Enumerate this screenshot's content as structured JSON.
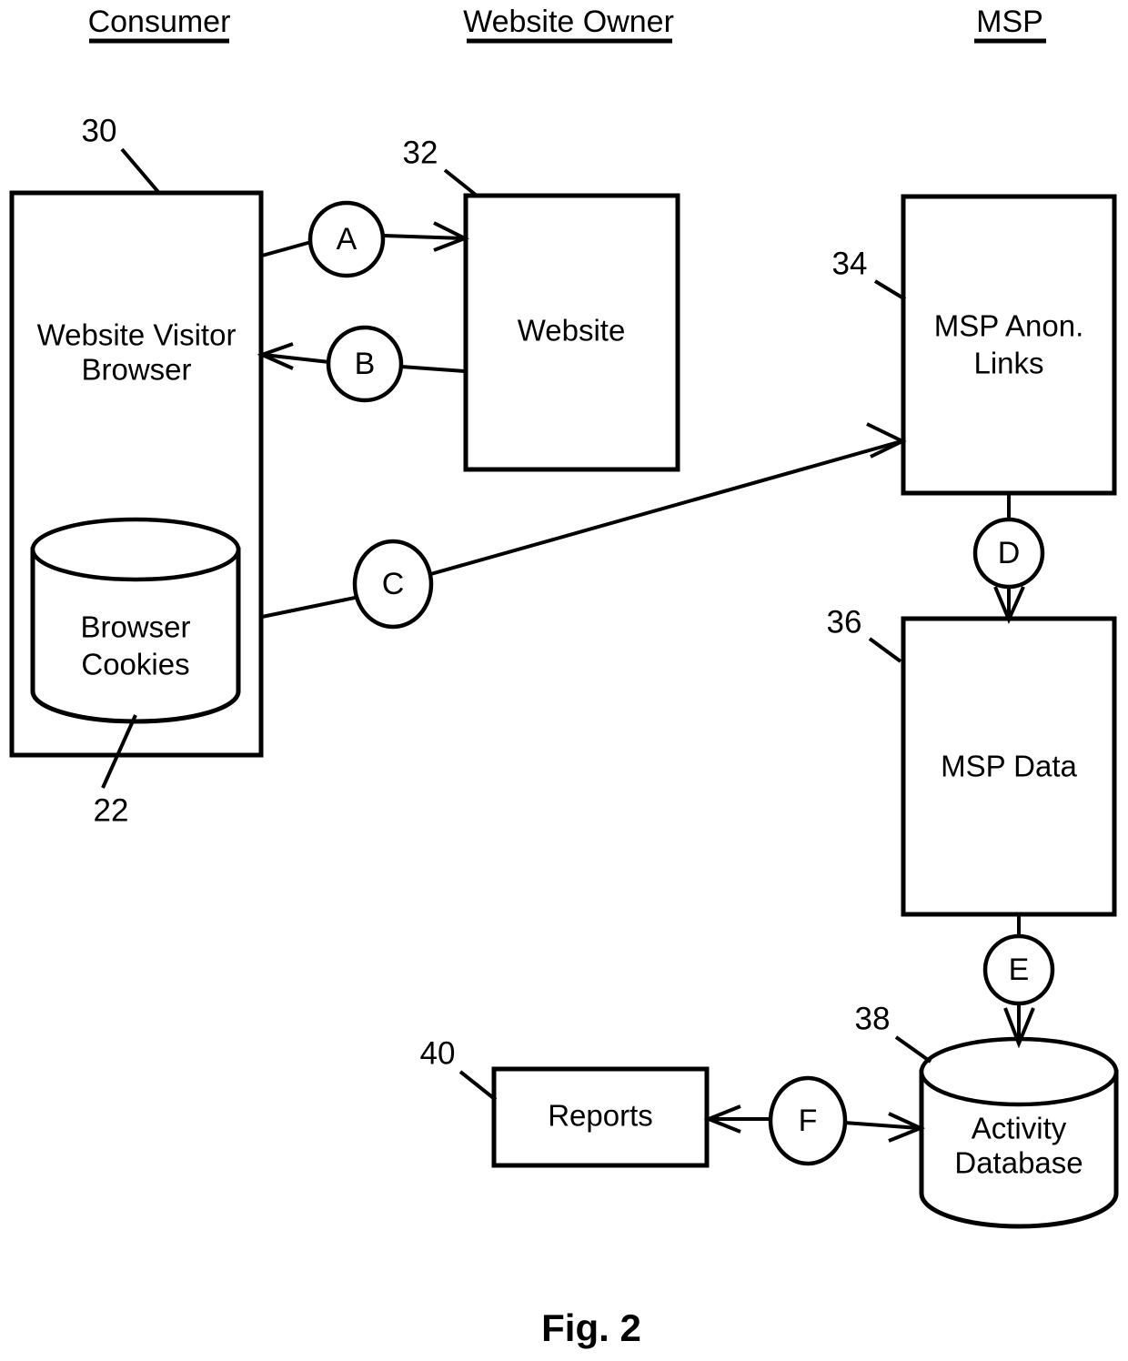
{
  "figure": {
    "caption": "Fig. 2"
  },
  "lanes": [
    {
      "id": "consumer",
      "label": "Consumer"
    },
    {
      "id": "website-owner",
      "label": "Website Owner"
    },
    {
      "id": "msp",
      "label": "MSP"
    }
  ],
  "nodes": [
    {
      "id": "website-visitor-browser",
      "label_line1": "Website Visitor",
      "label_line2": "Browser",
      "ref": "30",
      "shape": "rect"
    },
    {
      "id": "browser-cookies",
      "label_line1": "Browser",
      "label_line2": "Cookies",
      "ref": "22",
      "shape": "cylinder"
    },
    {
      "id": "website",
      "label_line1": "Website",
      "label_line2": "",
      "ref": "32",
      "shape": "rect"
    },
    {
      "id": "msp-anon-links",
      "label_line1": "MSP Anon.",
      "label_line2": "Links",
      "ref": "34",
      "shape": "rect"
    },
    {
      "id": "msp-data",
      "label_line1": "MSP Data",
      "label_line2": "",
      "ref": "36",
      "shape": "rect"
    },
    {
      "id": "activity-database",
      "label_line1": "Activity",
      "label_line2": "Database",
      "ref": "38",
      "shape": "cylinder"
    },
    {
      "id": "reports",
      "label_line1": "Reports",
      "label_line2": "",
      "ref": "40",
      "shape": "rect"
    }
  ],
  "flows": [
    {
      "id": "flow-a",
      "label": "A",
      "from": "website-visitor-browser",
      "to": "website"
    },
    {
      "id": "flow-b",
      "label": "B",
      "from": "website",
      "to": "website-visitor-browser"
    },
    {
      "id": "flow-c",
      "label": "C",
      "from": "website-visitor-browser",
      "to": "msp-anon-links"
    },
    {
      "id": "flow-d",
      "label": "D",
      "from": "msp-anon-links",
      "to": "msp-data"
    },
    {
      "id": "flow-e",
      "label": "E",
      "from": "msp-data",
      "to": "activity-database"
    },
    {
      "id": "flow-f",
      "label": "F",
      "from": "activity-database",
      "to": "reports"
    }
  ],
  "colors": {
    "stroke": "#000000",
    "fill": "#ffffff"
  }
}
